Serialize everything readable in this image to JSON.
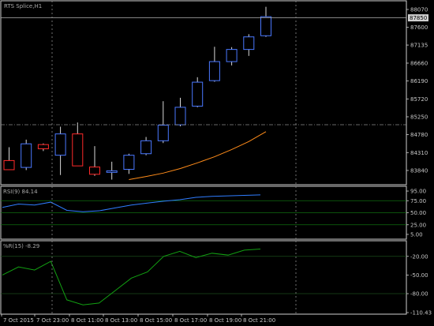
{
  "colors": {
    "background": "#000000",
    "grid": "#8c8c8c",
    "frame": "#cfcfcf",
    "bull": "#4a78ff",
    "bear": "#ff2a2a",
    "wick": "#d8d8d8",
    "price_line": "#b0b0b0",
    "ma": "#ff8c1a",
    "rsi": "#2f7dff",
    "rsi_level": "#0f6e0f",
    "wpr": "#12a012",
    "text": "#c8c8c8"
  },
  "chart_data": [
    {
      "type": "candlestick",
      "title": "RTS Splice,H1",
      "ylim": [
        83590,
        88070
      ],
      "y_ticks": [
        "88070",
        "87600",
        "87135",
        "86660",
        "86190",
        "85720",
        "85250",
        "84780",
        "84310",
        "83840"
      ],
      "current_price": "87850",
      "x_ticks": [
        "7 Oct 2015",
        "7 Oct 23:00",
        "8 Oct 11:00",
        "8 Oct 13:00",
        "8 Oct 15:00",
        "8 Oct 17:00",
        "8 Oct 19:00",
        "8 Oct 21:00"
      ],
      "candles": [
        {
          "open": 84100,
          "high": 84450,
          "low": 83860,
          "close": 83860
        },
        {
          "open": 83920,
          "high": 84650,
          "low": 83850,
          "close": 84540
        },
        {
          "open": 84520,
          "high": 84550,
          "low": 84350,
          "close": 84410
        },
        {
          "open": 84240,
          "high": 84990,
          "low": 83720,
          "close": 84800
        },
        {
          "open": 84800,
          "high": 85100,
          "low": 83960,
          "close": 83960
        },
        {
          "open": 83930,
          "high": 84480,
          "low": 83700,
          "close": 83740
        },
        {
          "open": 83790,
          "high": 84070,
          "low": 83600,
          "close": 83830
        },
        {
          "open": 83870,
          "high": 84280,
          "low": 83750,
          "close": 84240
        },
        {
          "open": 84280,
          "high": 84720,
          "low": 84240,
          "close": 84620
        },
        {
          "open": 84620,
          "high": 85660,
          "low": 84560,
          "close": 85030
        },
        {
          "open": 85040,
          "high": 85750,
          "low": 85000,
          "close": 85500
        },
        {
          "open": 85530,
          "high": 86290,
          "low": 85500,
          "close": 86160
        },
        {
          "open": 86200,
          "high": 87090,
          "low": 86170,
          "close": 86700
        },
        {
          "open": 86700,
          "high": 87080,
          "low": 86600,
          "close": 87020
        },
        {
          "open": 87020,
          "high": 87420,
          "low": 86850,
          "close": 87350
        },
        {
          "open": 87380,
          "high": 88140,
          "low": 87350,
          "close": 87880
        }
      ],
      "moving_average": [
        {
          "i": 7,
          "y": 83600
        },
        {
          "i": 8,
          "y": 83680
        },
        {
          "i": 9,
          "y": 83770
        },
        {
          "i": 10,
          "y": 83890
        },
        {
          "i": 11,
          "y": 84040
        },
        {
          "i": 12,
          "y": 84200
        },
        {
          "i": 13,
          "y": 84390
        },
        {
          "i": 14,
          "y": 84600
        },
        {
          "i": 15,
          "y": 84860
        }
      ]
    },
    {
      "type": "line",
      "title": "RSI(9) 84.14",
      "ylim": [
        0,
        100
      ],
      "y_ticks": [
        "95.00",
        "75.00",
        "50.00",
        "25.00",
        "5.00"
      ],
      "levels": [
        75,
        50,
        25
      ],
      "values": [
        61,
        68,
        66,
        72,
        55,
        52,
        54,
        60,
        66,
        70,
        74,
        77,
        82,
        84,
        85,
        86,
        87
      ]
    },
    {
      "type": "line",
      "title": "%R(15) -8.29",
      "ylim": [
        -110.43,
        0
      ],
      "y_ticks": [
        "-20.00",
        "-50.00",
        "-80.00",
        "-110.43"
      ],
      "levels": [
        -20,
        -80
      ],
      "values": [
        -50,
        -37,
        -42,
        -28,
        -90,
        -98,
        -95,
        -75,
        -55,
        -45,
        -20,
        -12,
        -22,
        -15,
        -18,
        -10,
        -8.29
      ]
    }
  ]
}
